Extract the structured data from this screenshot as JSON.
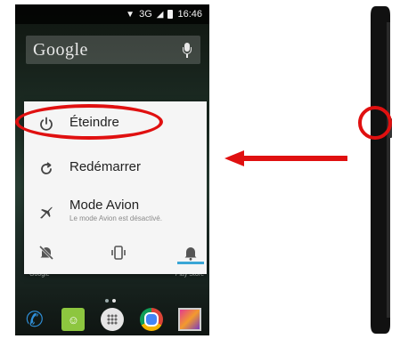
{
  "status_bar": {
    "network": "3G",
    "time": "16:46"
  },
  "search": {
    "logo_text": "Google"
  },
  "power_menu": {
    "items": [
      {
        "label": "Éteindre",
        "icon": "power-icon"
      },
      {
        "label": "Redémarrer",
        "icon": "restart-icon"
      },
      {
        "label": "Mode Avion",
        "sublabel": "Le mode Avion est désactivé.",
        "icon": "airplane-icon"
      }
    ],
    "sound_modes": [
      "silent-icon",
      "vibrate-icon",
      "bell-icon"
    ],
    "selected_mode": "bell-icon"
  },
  "home": {
    "labels": [
      "Google",
      "Play Store"
    ]
  },
  "dock": {
    "apps": [
      "phone-icon",
      "messaging-icon",
      "app-drawer-icon",
      "chrome-icon",
      "gallery-icon"
    ]
  },
  "colors": {
    "highlight": "#e01010",
    "mode_underline": "#3aa6d6",
    "dialog_bg": "#f5f5f5"
  }
}
